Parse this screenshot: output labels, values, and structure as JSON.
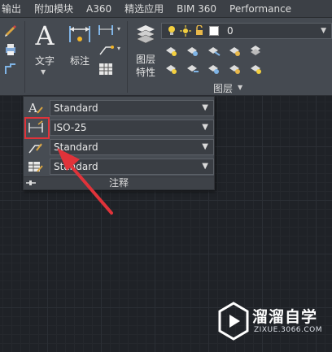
{
  "menubar": {
    "tabs": [
      "输出",
      "附加模块",
      "A360",
      "精选应用",
      "BIM 360",
      "Performance"
    ]
  },
  "ribbon": {
    "text_button": {
      "label": "文字",
      "glyph": "A"
    },
    "dimension_button": {
      "label": "标注"
    },
    "layer_properties_button": {
      "label_line1": "图层",
      "label_line2": "特性"
    },
    "layer_combo": {
      "value": "0"
    },
    "layer_panel_title": "图层"
  },
  "annotation_panel": {
    "rows": [
      {
        "icon": "text-style-icon",
        "value": "Standard"
      },
      {
        "icon": "dimension-style-icon",
        "value": "ISO-25"
      },
      {
        "icon": "multileader-style-icon",
        "value": "Standard"
      },
      {
        "icon": "table-style-icon",
        "value": "Standard"
      }
    ],
    "title": "注释",
    "arrow_glyph": "▼"
  },
  "annotation_overlay": {
    "highlight_color": "#e0333a"
  },
  "watermark": {
    "brand": "溜溜自学",
    "url": "ZIXUE.3066.COM"
  },
  "colors": {
    "menubar_bg": "#3c4046",
    "ribbon_bg": "#454a51",
    "canvas_bg": "#1f2227",
    "highlight": "#e0333a"
  }
}
